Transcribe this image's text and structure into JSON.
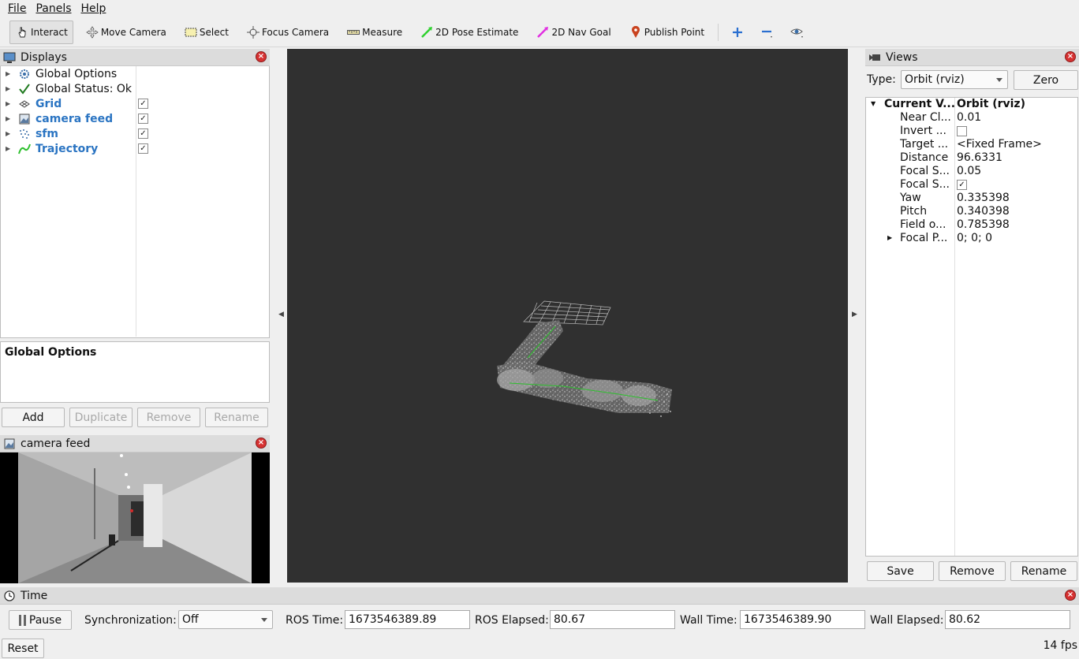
{
  "menu": [
    "File",
    "Panels",
    "Help"
  ],
  "toolbar": {
    "interact": "Interact",
    "move_camera": "Move Camera",
    "select": "Select",
    "focus_camera": "Focus Camera",
    "measure": "Measure",
    "pose_estimate": "2D Pose Estimate",
    "nav_goal": "2D Nav Goal",
    "publish_point": "Publish Point"
  },
  "displays": {
    "title": "Displays",
    "items": [
      {
        "label": "Global Options",
        "checked": null,
        "icon": "gear-icon"
      },
      {
        "label": "Global Status: Ok",
        "checked": null,
        "icon": "check-icon"
      },
      {
        "label": "Grid",
        "checked": true,
        "icon": "grid-icon"
      },
      {
        "label": "camera feed",
        "checked": true,
        "icon": "image-icon"
      },
      {
        "label": "sfm",
        "checked": true,
        "icon": "pointcloud-icon"
      },
      {
        "label": "Trajectory",
        "checked": true,
        "icon": "path-icon"
      }
    ],
    "description_title": "Global Options",
    "buttons": {
      "add": "Add",
      "duplicate": "Duplicate",
      "remove": "Remove",
      "rename": "Rename"
    }
  },
  "camera_panel": {
    "title": "camera feed"
  },
  "views": {
    "title": "Views",
    "type_label": "Type:",
    "type_value": "Orbit (rviz)",
    "zero": "Zero",
    "current_view_label": "Current V...",
    "current_view_value": "Orbit (rviz)",
    "props": [
      {
        "name": "Near Cl...",
        "value": "0.01"
      },
      {
        "name": "Invert ...",
        "value": ""
      },
      {
        "name": "Target ...",
        "value": "<Fixed Frame>"
      },
      {
        "name": "Distance",
        "value": "96.6331"
      },
      {
        "name": "Focal S...",
        "value": "0.05"
      },
      {
        "name": "Focal S...",
        "value": "✓"
      },
      {
        "name": "Yaw",
        "value": "0.335398"
      },
      {
        "name": "Pitch",
        "value": "0.340398"
      },
      {
        "name": "Field o...",
        "value": "0.785398"
      },
      {
        "name": "Focal P...",
        "value": "0; 0; 0"
      }
    ],
    "buttons": {
      "save": "Save",
      "remove": "Remove",
      "rename": "Rename"
    }
  },
  "time": {
    "title": "Time",
    "pause": "Pause",
    "sync_label": "Synchronization:",
    "sync_value": "Off",
    "ros_time_label": "ROS Time:",
    "ros_time": "1673546389.89",
    "ros_elapsed_label": "ROS Elapsed:",
    "ros_elapsed": "80.67",
    "wall_time_label": "Wall Time:",
    "wall_time": "1673546389.90",
    "wall_elapsed_label": "Wall Elapsed:",
    "wall_elapsed": "80.62",
    "reset": "Reset",
    "fps": "14 fps"
  }
}
